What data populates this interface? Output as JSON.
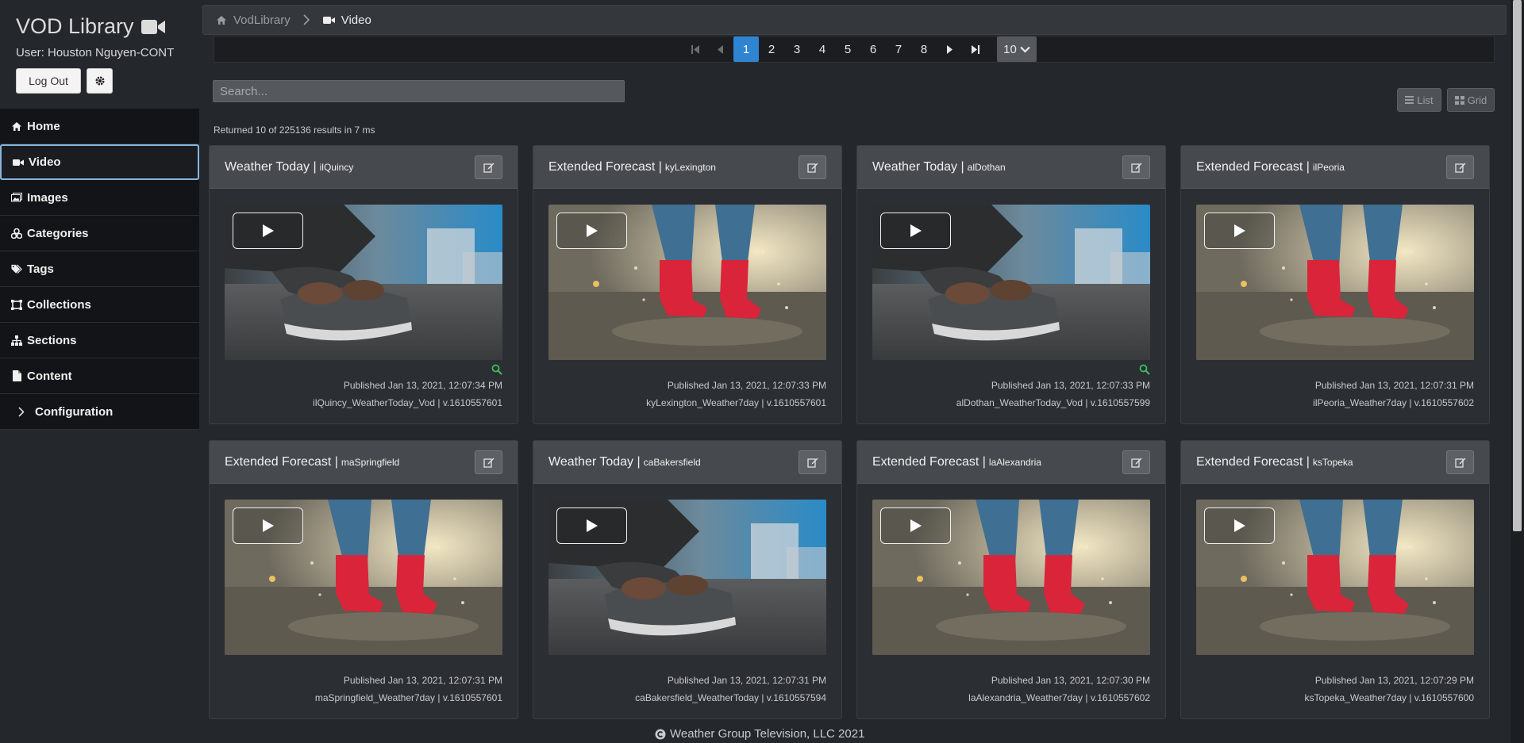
{
  "app": {
    "title": "VOD Library",
    "user": "User: Houston Nguyen-CONT",
    "logout": "Log Out"
  },
  "nav": [
    {
      "label": "Home",
      "icon": "home-icon"
    },
    {
      "label": "Video",
      "icon": "video-camera-icon",
      "active": true
    },
    {
      "label": "Images",
      "icon": "images-icon"
    },
    {
      "label": "Categories",
      "icon": "categories-icon"
    },
    {
      "label": "Tags",
      "icon": "tags-icon"
    },
    {
      "label": "Collections",
      "icon": "collections-icon"
    },
    {
      "label": "Sections",
      "icon": "sections-icon"
    },
    {
      "label": "Content",
      "icon": "content-icon"
    },
    {
      "label": "Configuration",
      "icon": "chevron-right-icon"
    }
  ],
  "breadcrumb": {
    "root": "VodLibrary",
    "current": "Video"
  },
  "pagination": {
    "pages": [
      "1",
      "2",
      "3",
      "4",
      "5",
      "6",
      "7",
      "8"
    ],
    "current": "1",
    "page_size": "10"
  },
  "search": {
    "placeholder": "Search..."
  },
  "view": {
    "list": "List",
    "grid": "Grid"
  },
  "results": "Returned 10 of 225136 results in 7 ms",
  "cards": [
    {
      "title": "Weather Today |",
      "market": "ilQuincy",
      "published": "Published Jan 13, 2021, 12:07:34 PM",
      "file": "ilQuincy_WeatherToday_Vod | v.1610557601",
      "scene": "shoe",
      "found": true
    },
    {
      "title": "Extended Forecast |",
      "market": "kyLexington",
      "published": "Published Jan 13, 2021, 12:07:33 PM",
      "file": "kyLexington_Weather7day | v.1610557601",
      "scene": "boots",
      "found": false
    },
    {
      "title": "Weather Today |",
      "market": "alDothan",
      "published": "Published Jan 13, 2021, 12:07:33 PM",
      "file": "alDothan_WeatherToday_Vod | v.1610557599",
      "scene": "shoe",
      "found": true
    },
    {
      "title": "Extended Forecast |",
      "market": "ilPeoria",
      "published": "Published Jan 13, 2021, 12:07:31 PM",
      "file": "ilPeoria_Weather7day | v.1610557602",
      "scene": "boots",
      "found": false
    },
    {
      "title": "Extended Forecast |",
      "market": "maSpringfield",
      "published": "Published Jan 13, 2021, 12:07:31 PM",
      "file": "maSpringfield_Weather7day | v.1610557601",
      "scene": "boots",
      "found": false
    },
    {
      "title": "Weather Today |",
      "market": "caBakersfield",
      "published": "Published Jan 13, 2021, 12:07:31 PM",
      "file": "caBakersfield_WeatherToday | v.1610557594",
      "scene": "shoe",
      "found": false
    },
    {
      "title": "Extended Forecast |",
      "market": "laAlexandria",
      "published": "Published Jan 13, 2021, 12:07:30 PM",
      "file": "laAlexandria_Weather7day | v.1610557602",
      "scene": "boots",
      "found": false
    },
    {
      "title": "Extended Forecast |",
      "market": "ksTopeka",
      "published": "Published Jan 13, 2021, 12:07:29 PM",
      "file": "ksTopeka_Weather7day | v.1610557600",
      "scene": "boots",
      "found": false
    }
  ],
  "footer": "Weather Group Television, LLC 2021"
}
